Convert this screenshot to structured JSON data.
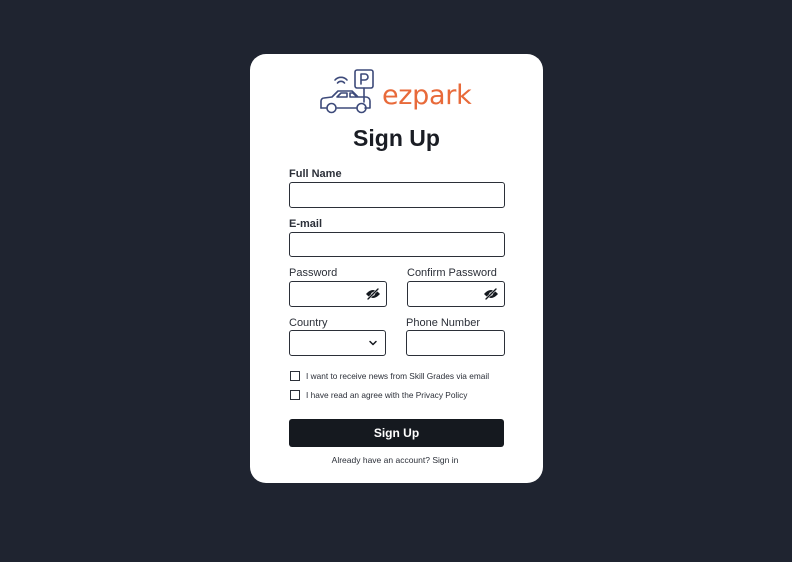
{
  "brand": {
    "name": "ezpark",
    "accent": "#e86a3a",
    "logo_icon": "car-parking-icon"
  },
  "title": "Sign Up",
  "fields": {
    "full_name": {
      "label": "Full Name",
      "value": ""
    },
    "email": {
      "label": "E-mail",
      "value": ""
    },
    "password": {
      "label": "Password",
      "value": "",
      "icon": "eye-off-icon"
    },
    "confirm_password": {
      "label": "Confirm Password",
      "value": "",
      "icon": "eye-off-icon"
    },
    "country": {
      "label": "Country",
      "value": "",
      "icon": "chevron-down-icon"
    },
    "phone": {
      "label": "Phone Number",
      "value": ""
    }
  },
  "checkboxes": [
    {
      "label": "I want to receive news from Skill Grades via email",
      "checked": false
    },
    {
      "label": "I have read an agree with the Privacy Policy",
      "checked": false
    }
  ],
  "submit_label": "Sign Up",
  "footer_text": "Already have an account? Sign in",
  "colors": {
    "background": "#1f2430",
    "card": "#ffffff",
    "button": "#15191f"
  }
}
